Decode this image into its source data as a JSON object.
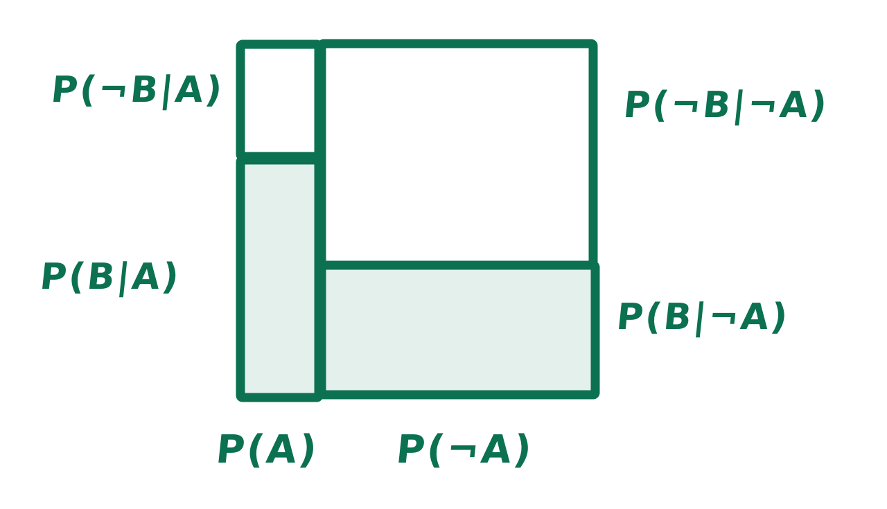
{
  "colors": {
    "stroke": "#0b7150",
    "fill_b": "#e3f0ec",
    "fill_not_b": "#ffffff",
    "background": "#ffffff"
  },
  "labels": {
    "p_not_b_given_a": "P(¬B|A)",
    "p_b_given_a": "P(B|A)",
    "p_not_b_given_not_a": "P(¬B|¬A)",
    "p_b_given_not_a": "P(B|¬A)",
    "p_a": "P(A)",
    "p_not_a": "P(¬A)"
  }
}
